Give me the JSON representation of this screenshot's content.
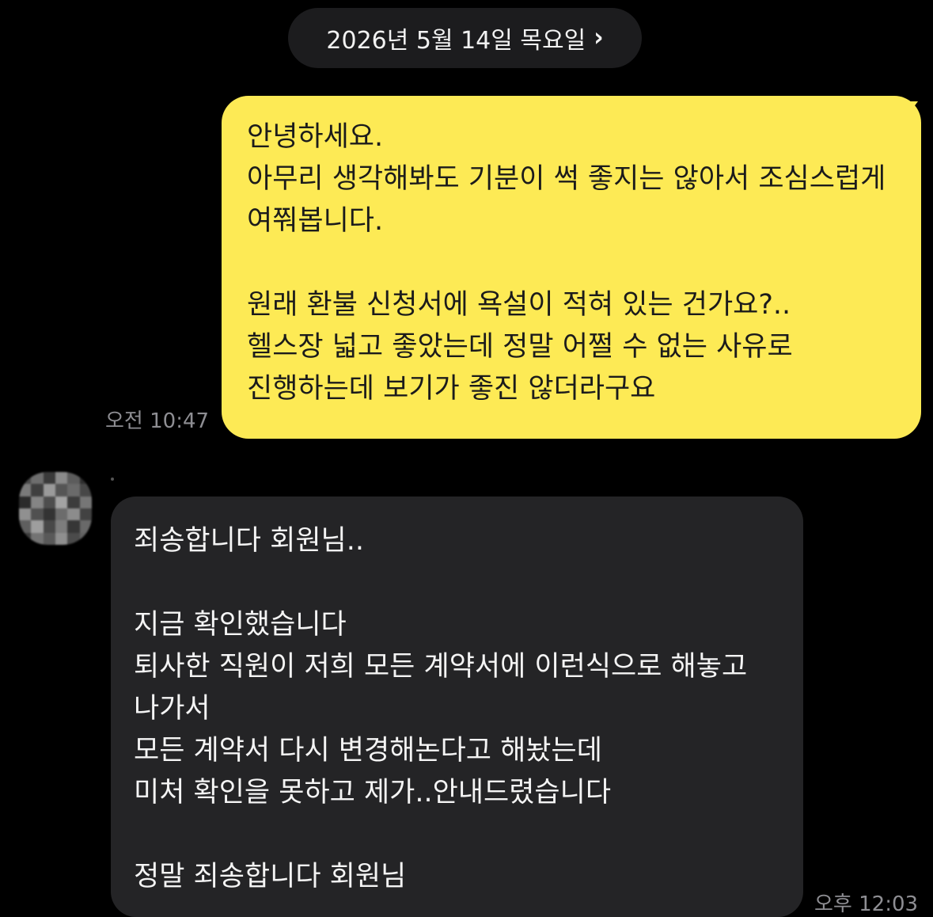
{
  "header": {
    "date_label": "2026년 5월 14일 목요일",
    "chevron": "›",
    "chevron_icon": "chevron-right-icon"
  },
  "colors": {
    "background": "#000000",
    "sent_bubble": "#fdea55",
    "received_bubble": "#242426",
    "timestamp": "#8e8e93"
  },
  "messages": [
    {
      "direction": "sent",
      "text": "안녕하세요.\n아무리 생각해봐도 기분이 썩 좋지는 않아서 조심스럽게 여쭤봅니다.\n\n원래 환불 신청서에 욕설이 적혀 있는 건가요?..\n헬스장 넓고 좋았는데 정말 어쩔 수 없는 사유로 진행하는데 보기가 좋진 않더라구요",
      "time": "오전 10:47"
    },
    {
      "direction": "received",
      "sender_avatar": "blurred-avatar",
      "text": "죄송합니다 회원님..\n\n지금 확인했습니다\n퇴사한 직원이 저희 모든 계약서에 이런식으로 해놓고 나가서\n모든 계약서 다시 변경해논다고 해놨는데\n미처 확인을 못하고 제가..안내드렸습니다\n\n정말 죄송합니다 회원님",
      "time": "오후 12:03"
    }
  ]
}
